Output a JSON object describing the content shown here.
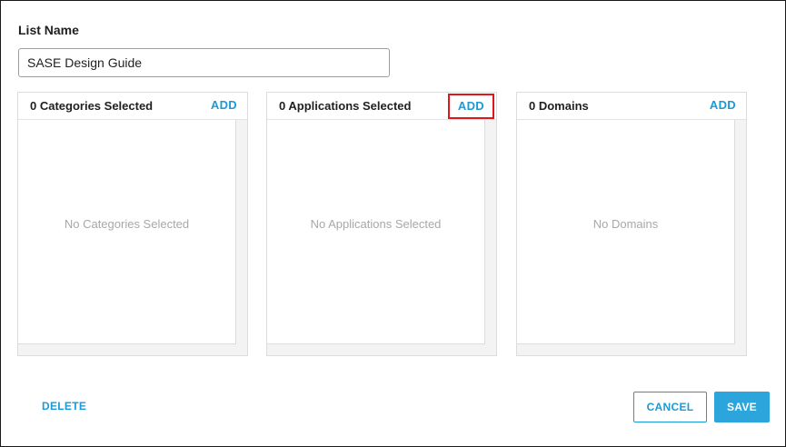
{
  "form": {
    "list_name_label": "List Name",
    "list_name_value": "SASE Design Guide"
  },
  "panels": [
    {
      "title": "0 Categories Selected",
      "add_label": "ADD",
      "empty_text": "No Categories Selected",
      "highlighted": false
    },
    {
      "title": "0 Applications Selected",
      "add_label": "ADD",
      "empty_text": "No Applications Selected",
      "highlighted": true
    },
    {
      "title": "0 Domains",
      "add_label": "ADD",
      "empty_text": "No Domains",
      "highlighted": false
    }
  ],
  "footer": {
    "delete_label": "DELETE",
    "cancel_label": "CANCEL",
    "save_label": "SAVE"
  },
  "colors": {
    "accent": "#1a9ad6",
    "save_bg": "#2ba5db",
    "highlight_border": "#e0161b",
    "empty_text": "#a8a8a8"
  }
}
